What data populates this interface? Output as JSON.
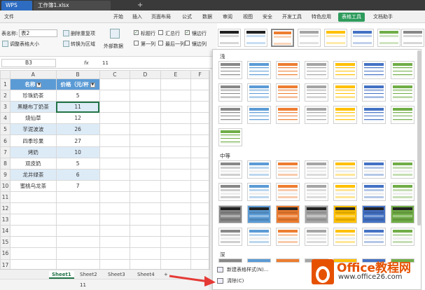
{
  "titlebar": {
    "app": "WPS",
    "file": "工作簿1.xlsx",
    "plus": "+"
  },
  "menu": {
    "file": "文件",
    "items": [
      "开始",
      "插入",
      "页面布局",
      "公式",
      "数据",
      "审阅",
      "视图",
      "安全",
      "开发工具",
      "特色应用"
    ],
    "active": "表格工具",
    "last": "文档助手"
  },
  "ribbon": {
    "table_name_label": "表名称:",
    "table_name_value": "表2",
    "resize": "调整表格大小",
    "remove_dup": "删除重复项",
    "to_range": "转换为区域",
    "external": "外部数据",
    "header_row": "标题行",
    "total_row": "汇总行",
    "banded_rows": "镶边行",
    "first_col": "第一列",
    "last_col": "最后一列",
    "banded_cols": "镶边列"
  },
  "formula": {
    "cell": "B3",
    "fx": "fx",
    "value": "11"
  },
  "columns": [
    "A",
    "B",
    "C",
    "D",
    "E",
    "F"
  ],
  "table": {
    "headers": [
      "名称",
      "价格（元/杯"
    ],
    "rows": [
      [
        "珍珠奶茶",
        "5"
      ],
      [
        "黑糖布丁奶茶",
        "11"
      ],
      [
        "烧仙草",
        "12"
      ],
      [
        "芋泥波波",
        "26"
      ],
      [
        "四季珍果",
        "27"
      ],
      [
        "烤奶",
        "10"
      ],
      [
        "双皮奶",
        "5"
      ],
      [
        "龙井绿茶",
        "6"
      ],
      [
        "蜜桃乌龙茶",
        "7"
      ]
    ],
    "row_numbers": [
      "1",
      "2",
      "3",
      "4",
      "5",
      "6",
      "7",
      "8",
      "9",
      "10",
      "11",
      "12",
      "13",
      "14",
      "15",
      "16",
      "17"
    ]
  },
  "sheets": [
    "Sheet1",
    "Sheet2",
    "Sheet3",
    "Sheet4"
  ],
  "status": {
    "value": "11"
  },
  "panel": {
    "light": "浅",
    "medium": "中等",
    "dark": "深",
    "new_style": "新建表格样式(N)...",
    "clear": "清除(C)"
  },
  "colors": {
    "light": [
      "#888888",
      "#5b9bd5",
      "#ed7d31",
      "#a5a5a5",
      "#ffc000",
      "#4472c4",
      "#70ad47"
    ],
    "accent_green": "#217346",
    "menu_active": "#2e9b5c"
  },
  "watermark": {
    "brand": "Office教程网",
    "url": "www.office26.com"
  }
}
